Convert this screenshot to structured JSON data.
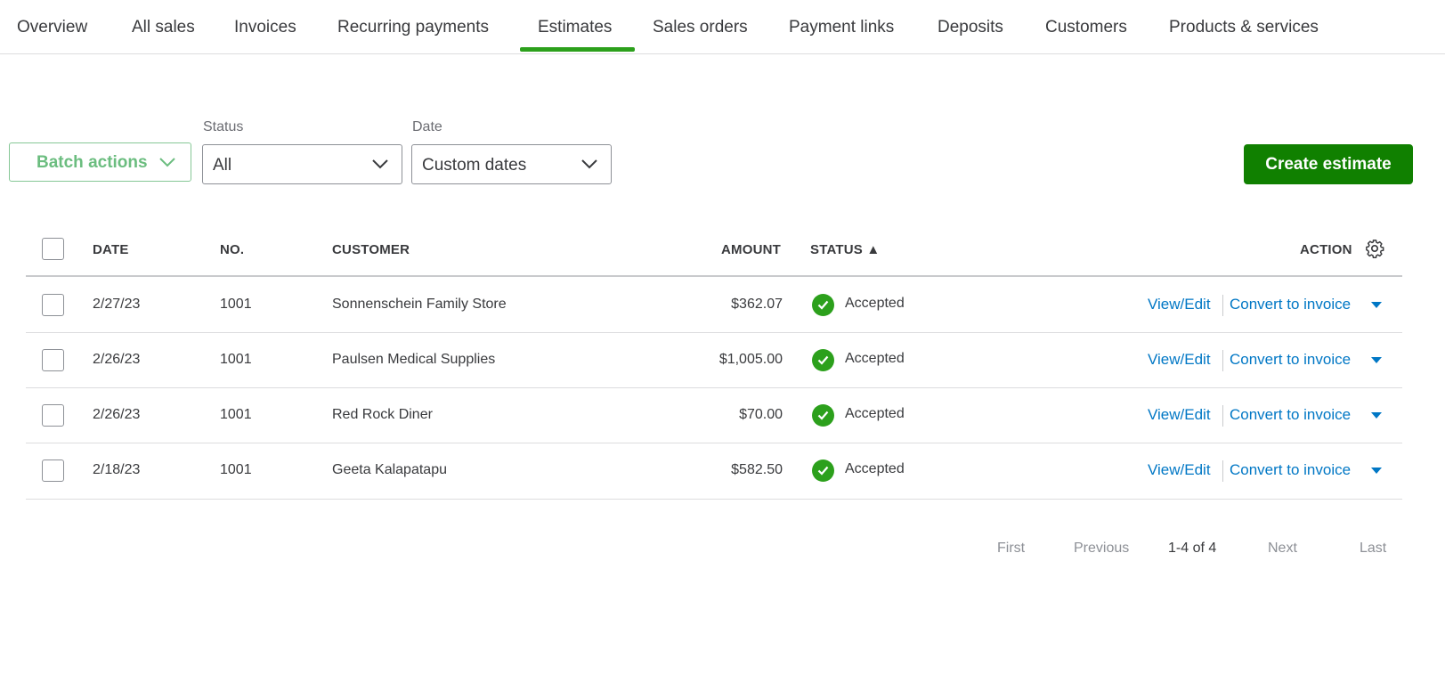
{
  "tabs": [
    {
      "label": "Overview"
    },
    {
      "label": "All sales"
    },
    {
      "label": "Invoices"
    },
    {
      "label": "Recurring payments"
    },
    {
      "label": "Estimates",
      "active": true
    },
    {
      "label": "Sales orders"
    },
    {
      "label": "Payment links"
    },
    {
      "label": "Deposits"
    },
    {
      "label": "Customers"
    },
    {
      "label": "Products & services"
    }
  ],
  "filters": {
    "batch_actions": "Batch actions",
    "status_label": "Status",
    "status_value": "All",
    "date_label": "Date",
    "date_value": "Custom dates"
  },
  "create_button": "Create estimate",
  "table": {
    "headers": {
      "date": "DATE",
      "no": "NO.",
      "customer": "CUSTOMER",
      "amount": "AMOUNT",
      "status": "STATUS ▲",
      "action": "ACTION"
    },
    "rows": [
      {
        "date": "2/27/23",
        "no": "1001",
        "customer": "Sonnenschein Family Store",
        "amount": "$362.07",
        "status": "Accepted",
        "view": "View/Edit",
        "convert": "Convert to invoice"
      },
      {
        "date": "2/26/23",
        "no": "1001",
        "customer": "Paulsen Medical Supplies",
        "amount": "$1,005.00",
        "status": "Accepted",
        "view": "View/Edit",
        "convert": "Convert to invoice"
      },
      {
        "date": "2/26/23",
        "no": "1001",
        "customer": "Red Rock Diner",
        "amount": "$70.00",
        "status": "Accepted",
        "view": "View/Edit",
        "convert": "Convert to invoice"
      },
      {
        "date": "2/18/23",
        "no": "1001",
        "customer": "Geeta Kalapatapu",
        "amount": "$582.50",
        "status": "Accepted",
        "view": "View/Edit",
        "convert": "Convert to invoice"
      }
    ]
  },
  "pagination": {
    "first": "First",
    "previous": "Previous",
    "range": "1-4 of 4",
    "next": "Next",
    "last": "Last"
  },
  "colors": {
    "accent": "#2ca01c",
    "primary_button": "#108000",
    "link": "#0077c5"
  }
}
